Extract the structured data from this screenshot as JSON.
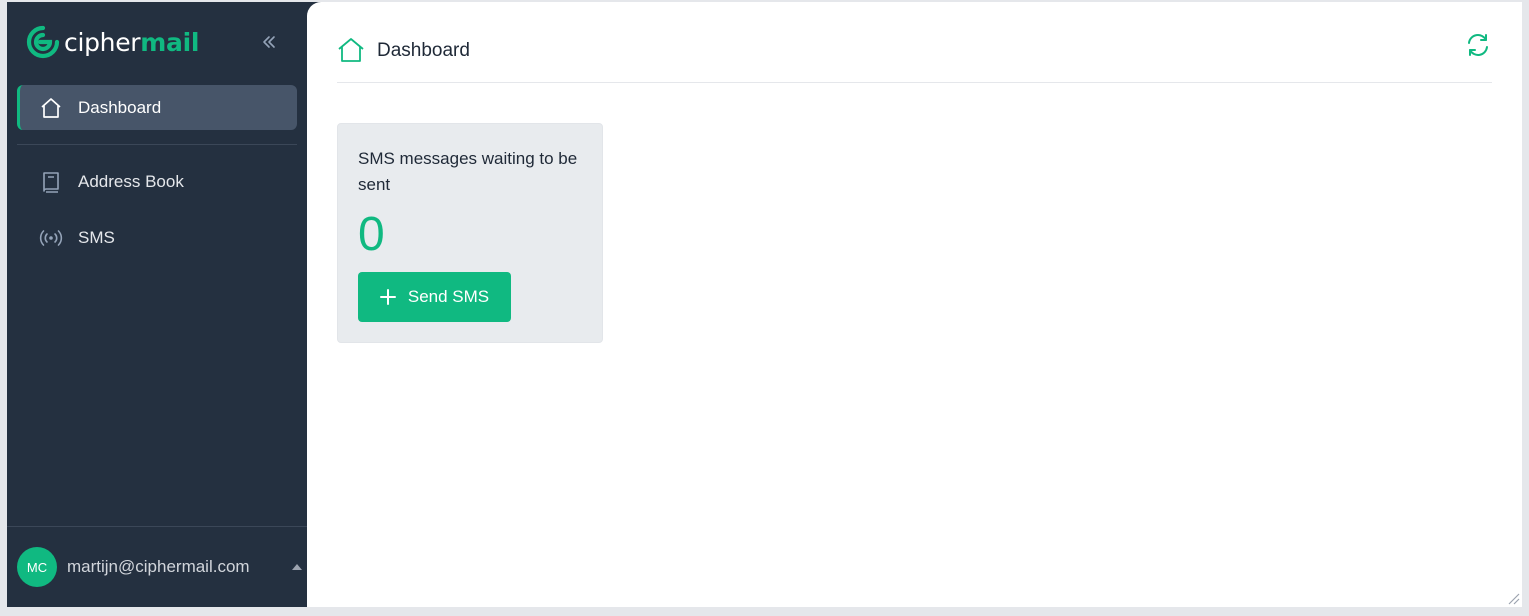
{
  "brand": {
    "cipher": "cipher",
    "mail": "mail"
  },
  "sidebar": {
    "items": [
      {
        "label": "Dashboard",
        "icon": "home-icon",
        "active": true
      },
      {
        "label": "Address Book",
        "icon": "book-icon",
        "active": false
      },
      {
        "label": "SMS",
        "icon": "broadcast-icon",
        "active": false
      }
    ],
    "collapse_icon": "double-chevron-left-icon"
  },
  "user": {
    "initials": "MC",
    "email": "martijn@ciphermail.com"
  },
  "header": {
    "title": "Dashboard",
    "icon": "home-icon",
    "refresh_icon": "refresh-icon"
  },
  "card": {
    "title": "SMS messages waiting to be sent",
    "count": "0",
    "button_label": "Send SMS",
    "button_icon": "plus-icon"
  },
  "colors": {
    "accent": "#10b981",
    "sidebar_bg": "#243040",
    "active_item": "#475569",
    "card_bg": "#e8ebee"
  }
}
